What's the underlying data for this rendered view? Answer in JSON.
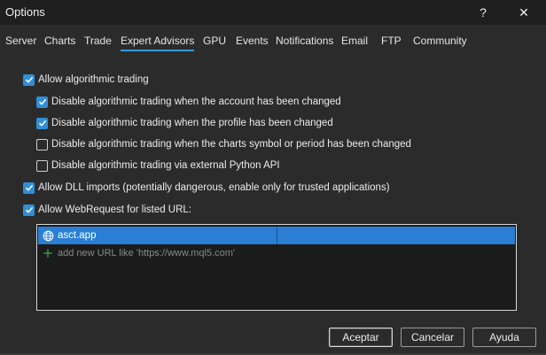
{
  "window": {
    "title": "Options",
    "help_label": "?",
    "close_label": "✕"
  },
  "tabs": [
    {
      "label": "Server"
    },
    {
      "label": "Charts"
    },
    {
      "label": "Trade"
    },
    {
      "label": "Expert Advisors",
      "active": true
    },
    {
      "label": "GPU"
    },
    {
      "label": "Events"
    },
    {
      "label": "Notifications"
    },
    {
      "label": "Email"
    },
    {
      "label": "FTP"
    },
    {
      "label": "Community"
    }
  ],
  "options": {
    "allow_algo": {
      "label": "Allow algorithmic trading",
      "checked": true
    },
    "disable_account": {
      "label": "Disable algorithmic trading when the account has been changed",
      "checked": true
    },
    "disable_profile": {
      "label": "Disable algorithmic trading when the profile has been changed",
      "checked": true
    },
    "disable_symbol": {
      "label": "Disable algorithmic trading when the charts symbol or period has been changed",
      "checked": false
    },
    "disable_python": {
      "label": "Disable algorithmic trading via external Python API",
      "checked": false
    },
    "allow_dll": {
      "label": "Allow DLL imports (potentially dangerous, enable only for trusted applications)",
      "checked": true
    },
    "allow_webrequest": {
      "label": "Allow WebRequest for listed URL:",
      "checked": true
    }
  },
  "url_list": {
    "items": [
      {
        "url": "asct.app",
        "icon": "globe-icon"
      }
    ],
    "add_placeholder": "add new URL like 'https://www.mql5.com'"
  },
  "buttons": {
    "accept": "Aceptar",
    "cancel": "Cancelar",
    "help": "Ayuda"
  },
  "colors": {
    "accent": "#2f8fd8",
    "selection": "#2a7fd4",
    "background": "#2b2b2b",
    "titlebar": "#1f1f1f"
  }
}
